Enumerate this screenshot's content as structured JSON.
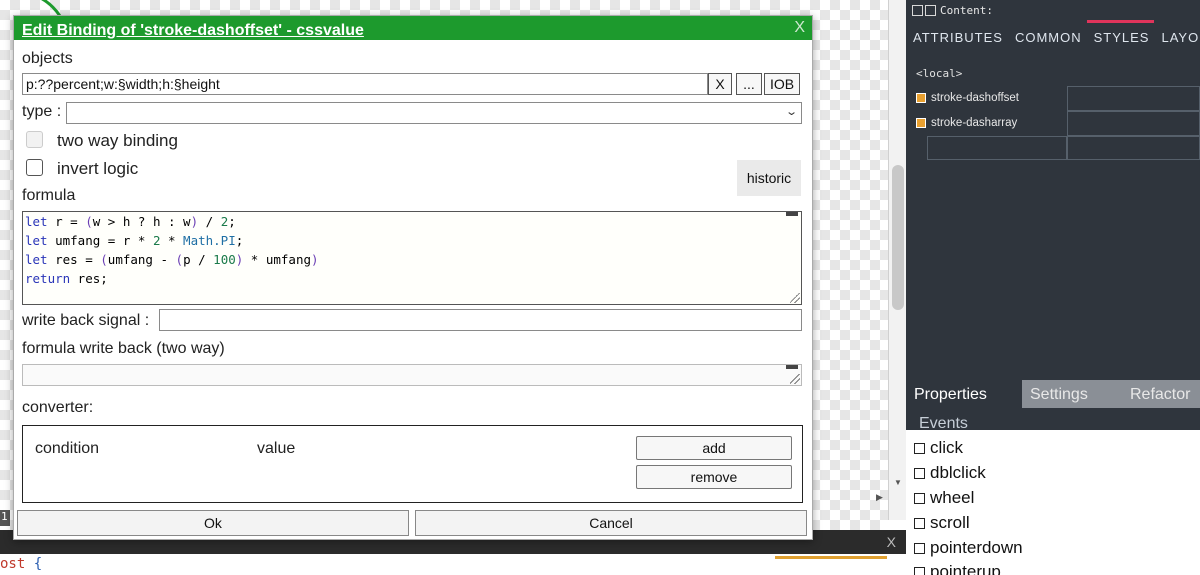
{
  "dialog": {
    "title": "Edit Binding of 'stroke-dashoffset' - cssvalue",
    "close_label": "X",
    "objects_label": "objects",
    "objects_value": "p:??percent;w:§width;h:§height",
    "clear_button": "X",
    "more_button": "...",
    "iob_button": "IOB",
    "type_label": "type :",
    "type_value": "",
    "two_way_label": "two way binding",
    "invert_label": "invert logic",
    "historic_button": "historic",
    "formula_label": "formula",
    "formula_lines": [
      "let r = (w > h ? h : w) / 2;",
      "let umfang = r * 2 * Math.PI;",
      "let res = (umfang - (p / 100) * umfang)",
      "return res;"
    ],
    "write_back_label": "write back signal :",
    "write_back_value": "",
    "formula_write_back_label": "formula write back (two way)",
    "formula_write_back_value": "",
    "converter_label": "converter:",
    "converter": {
      "condition_header": "condition",
      "value_header": "value",
      "add_button": "add",
      "remove_button": "remove"
    },
    "ok_button": "Ok",
    "cancel_button": "Cancel"
  },
  "right_panel": {
    "content_label": "Content:",
    "tabs": [
      "ATTRIBUTES",
      "COMMON",
      "STYLES",
      "LAYO"
    ],
    "active_tab": "STYLES",
    "tab_overflow_icon": "<",
    "local_label": "<local>",
    "style_rows": [
      {
        "name": "stroke-dashoffset",
        "value": ""
      },
      {
        "name": "stroke-dasharray",
        "value": ""
      }
    ],
    "bottom_tabs": [
      "Properties",
      "Settings",
      "Refactor"
    ],
    "events_header": "Events",
    "events": [
      "click",
      "dblclick",
      "wheel",
      "scroll",
      "pointerdown",
      "pointerup"
    ]
  },
  "editor": {
    "line_number": "1",
    "code_line_text": "ost",
    "code_line_brace": "{",
    "close_label": "X"
  },
  "colors": {
    "dialog_title_bar": "#1d9a2d",
    "panel_bg": "#2f353d",
    "active_tab_accent": "#e0345b",
    "style_marker": "#e8a030"
  }
}
